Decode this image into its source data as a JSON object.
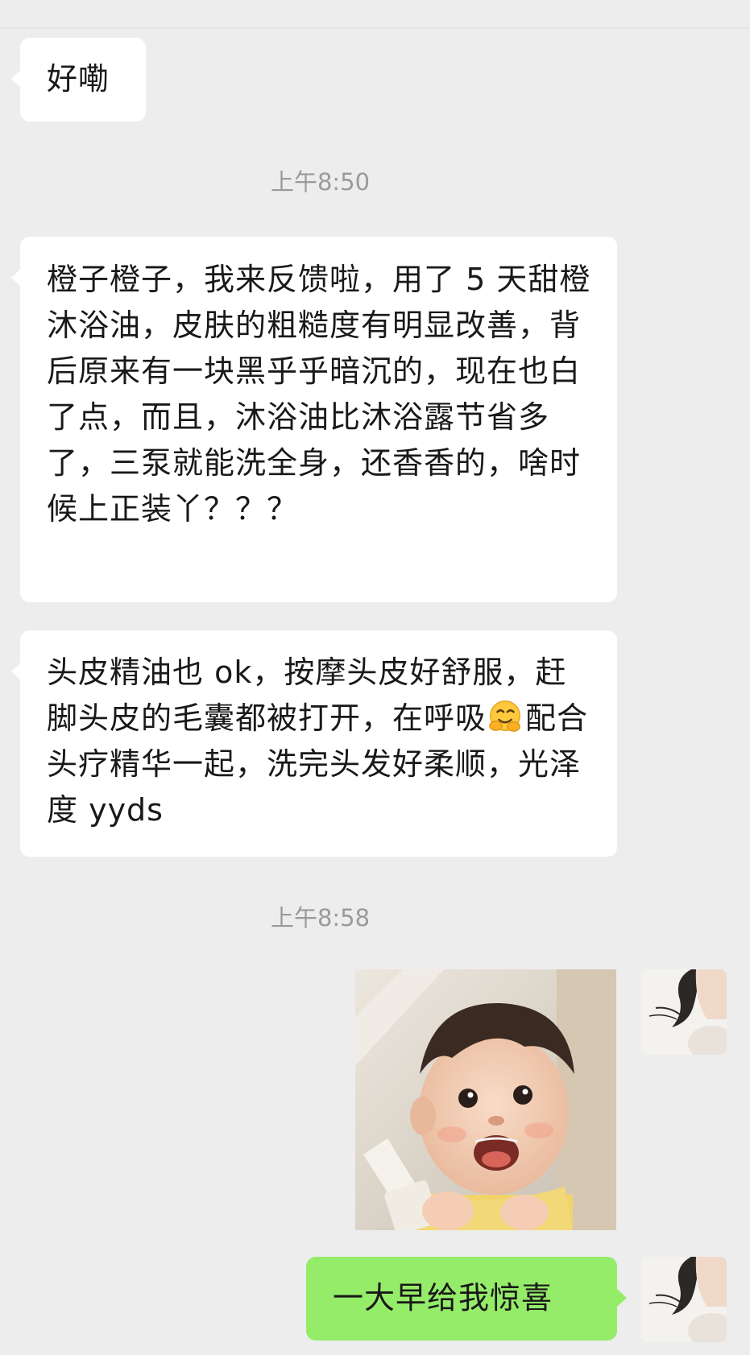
{
  "conversation": {
    "messages": [
      {
        "id": "m1",
        "side": "left",
        "text": "好嘞"
      },
      {
        "id": "t1",
        "type": "timestamp",
        "text": "上午8:50"
      },
      {
        "id": "m2",
        "side": "left",
        "text": "橙子橙子，我来反馈啦，用了 5 天甜橙沐浴油，皮肤的粗糙度有明显改善，背后原来有一块黑乎乎暗沉的，现在也白了点，而且，沐浴油比沐浴露节省多了，三泵就能洗全身，还香香的，啥时候上正装丫？？？"
      },
      {
        "id": "m3",
        "side": "left",
        "text_before_emoji": "头皮精油也 ok，按摩头皮好舒服，赶脚头皮的毛囊都被打开，在呼吸",
        "emoji": "hugging-face-emoji",
        "text_after_emoji": "配合头疗精华一起，洗完头发好柔顺，光泽度 yyds"
      },
      {
        "id": "t2",
        "type": "timestamp",
        "text": "上午8:58"
      },
      {
        "id": "m4",
        "side": "right",
        "type": "image",
        "content": "photo of a smiling toddler"
      },
      {
        "id": "m5",
        "side": "right",
        "text": "一大早给我惊喜"
      }
    ]
  },
  "colors": {
    "background": "#ededed",
    "left_bubble": "#ffffff",
    "right_bubble": "#95ec69",
    "timestamp_text": "#9a9a9a",
    "message_text": "#191919"
  },
  "icons": {
    "emoji": "hugging-face-emoji",
    "avatar": "user-avatar-woman-profile"
  }
}
